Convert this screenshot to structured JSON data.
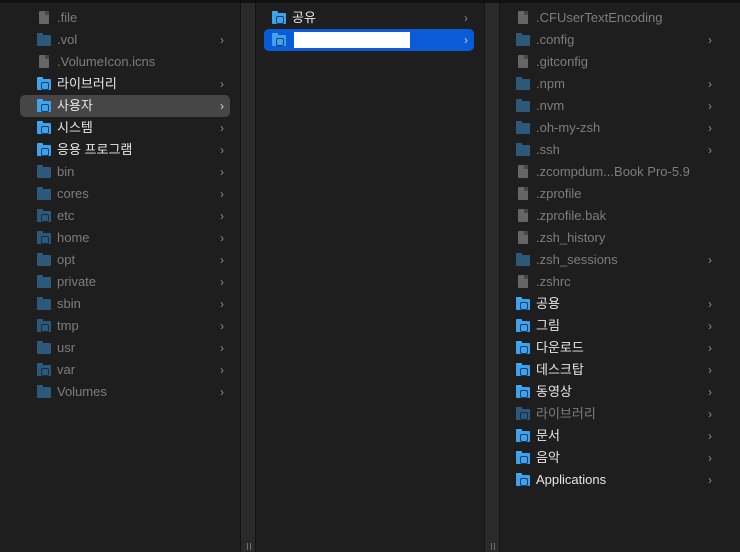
{
  "columns": [
    {
      "items": [
        {
          "label": ".file",
          "icon": "file-icon",
          "dim": true,
          "chevron": false
        },
        {
          "label": ".vol",
          "icon": "folder-icon",
          "dim": true,
          "chevron": true
        },
        {
          "label": ".VolumeIcon.icns",
          "icon": "file-icon",
          "dim": true,
          "chevron": false
        },
        {
          "label": "라이브러리",
          "icon": "library-folder-icon",
          "dim": false,
          "chevron": true
        },
        {
          "label": "사용자",
          "icon": "users-folder-icon",
          "dim": false,
          "chevron": true,
          "selected": "gray"
        },
        {
          "label": "시스템",
          "icon": "system-folder-icon",
          "dim": false,
          "chevron": true
        },
        {
          "label": "응용 프로그램",
          "icon": "applications-folder-icon",
          "dim": false,
          "chevron": true
        },
        {
          "label": "bin",
          "icon": "folder-icon",
          "dim": true,
          "chevron": true
        },
        {
          "label": "cores",
          "icon": "folder-icon",
          "dim": true,
          "chevron": true
        },
        {
          "label": "etc",
          "icon": "alias-folder-icon",
          "dim": true,
          "chevron": true
        },
        {
          "label": "home",
          "icon": "server-folder-icon",
          "dim": true,
          "chevron": true
        },
        {
          "label": "opt",
          "icon": "folder-icon",
          "dim": true,
          "chevron": true
        },
        {
          "label": "private",
          "icon": "folder-icon",
          "dim": true,
          "chevron": true
        },
        {
          "label": "sbin",
          "icon": "folder-icon",
          "dim": true,
          "chevron": true
        },
        {
          "label": "tmp",
          "icon": "alias-folder-icon",
          "dim": true,
          "chevron": true
        },
        {
          "label": "usr",
          "icon": "folder-icon",
          "dim": true,
          "chevron": true
        },
        {
          "label": "var",
          "icon": "alias-folder-icon",
          "dim": true,
          "chevron": true
        },
        {
          "label": "Volumes",
          "icon": "folder-icon",
          "dim": true,
          "chevron": true
        }
      ]
    },
    {
      "items": [
        {
          "label": "공유",
          "icon": "shared-folder-icon",
          "dim": false,
          "chevron": true
        },
        {
          "label": "",
          "icon": "home-folder-icon",
          "dim": false,
          "chevron": true,
          "selected": "blue",
          "redacted": true
        }
      ]
    },
    {
      "items": [
        {
          "label": ".CFUserTextEncoding",
          "icon": "file-icon",
          "dim": true,
          "chevron": false
        },
        {
          "label": ".config",
          "icon": "folder-icon",
          "dim": true,
          "chevron": true
        },
        {
          "label": ".gitconfig",
          "icon": "file-icon",
          "dim": true,
          "chevron": false
        },
        {
          "label": ".npm",
          "icon": "folder-icon",
          "dim": true,
          "chevron": true
        },
        {
          "label": ".nvm",
          "icon": "folder-icon",
          "dim": true,
          "chevron": true
        },
        {
          "label": ".oh-my-zsh",
          "icon": "folder-icon",
          "dim": true,
          "chevron": true
        },
        {
          "label": ".ssh",
          "icon": "folder-icon",
          "dim": true,
          "chevron": true
        },
        {
          "label": ".zcompdum...Book Pro-5.9",
          "icon": "file-icon",
          "dim": true,
          "chevron": false
        },
        {
          "label": ".zprofile",
          "icon": "file-icon",
          "dim": true,
          "chevron": false
        },
        {
          "label": ".zprofile.bak",
          "icon": "file-icon",
          "dim": true,
          "chevron": false
        },
        {
          "label": ".zsh_history",
          "icon": "file-icon",
          "dim": true,
          "chevron": false
        },
        {
          "label": ".zsh_sessions",
          "icon": "folder-icon",
          "dim": true,
          "chevron": true
        },
        {
          "label": ".zshrc",
          "icon": "file-icon",
          "dim": true,
          "chevron": false
        },
        {
          "label": "공용",
          "icon": "public-folder-icon",
          "dim": false,
          "chevron": true
        },
        {
          "label": "그림",
          "icon": "pictures-folder-icon",
          "dim": false,
          "chevron": true
        },
        {
          "label": "다운로드",
          "icon": "downloads-folder-icon",
          "dim": false,
          "chevron": true
        },
        {
          "label": "데스크탑",
          "icon": "desktop-folder-icon",
          "dim": false,
          "chevron": true
        },
        {
          "label": "동영상",
          "icon": "movies-folder-icon",
          "dim": false,
          "chevron": true
        },
        {
          "label": "라이브러리",
          "icon": "library-folder-icon",
          "dim": true,
          "chevron": true
        },
        {
          "label": "문서",
          "icon": "documents-folder-icon",
          "dim": false,
          "chevron": true
        },
        {
          "label": "음악",
          "icon": "music-folder-icon",
          "dim": false,
          "chevron": true
        },
        {
          "label": "Applications",
          "icon": "applications-folder-icon",
          "dim": false,
          "chevron": true
        }
      ]
    }
  ],
  "colors": {
    "background": "#1e1e1e",
    "selection_active": "#0a5bd8",
    "selection_inactive": "#464646",
    "folder": "#3fa2ea",
    "text": "#e6e6e6",
    "text_dim": "#7d7d7d"
  },
  "chevron_glyph": "›"
}
